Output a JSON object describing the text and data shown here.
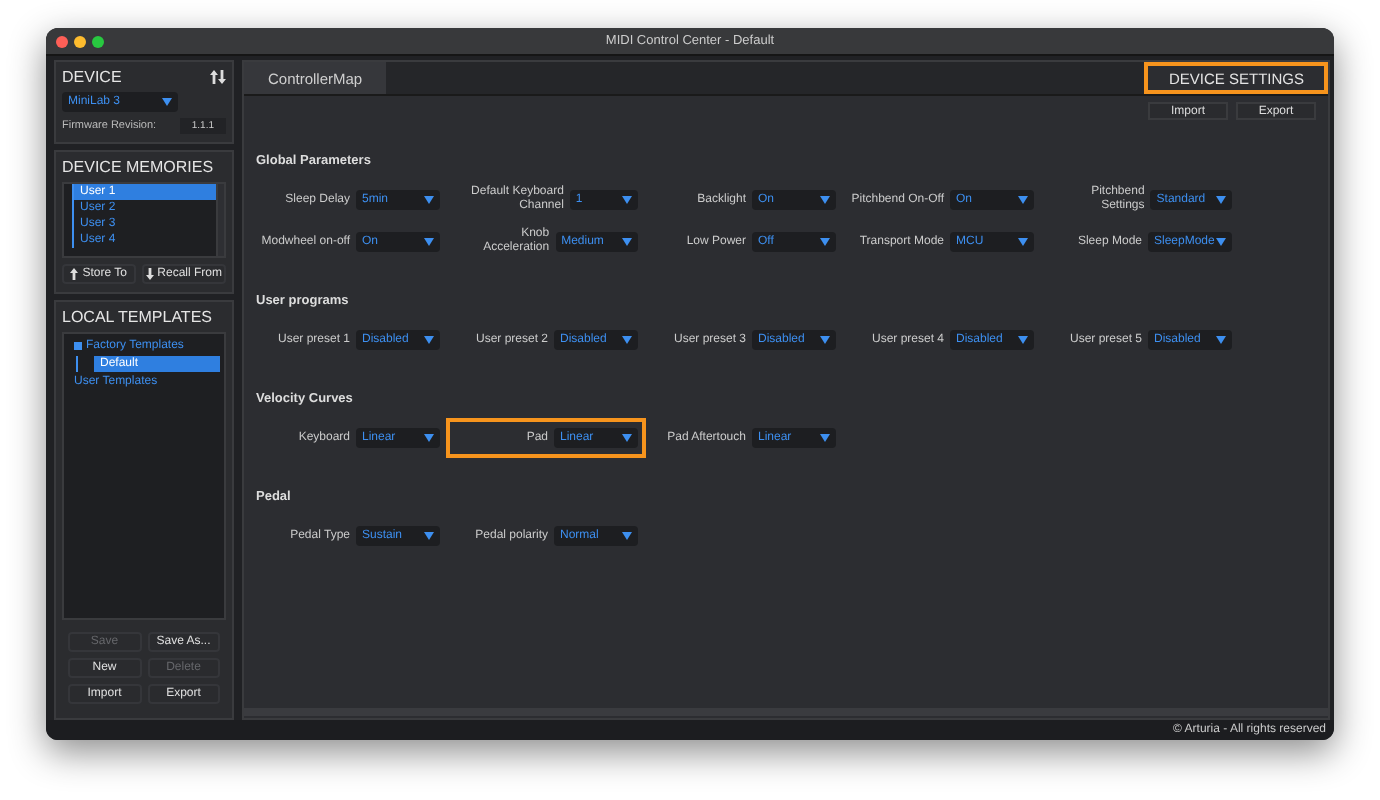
{
  "window": {
    "title": "MIDI Control Center - Default"
  },
  "device": {
    "heading": "DEVICE",
    "model": "MiniLab 3",
    "firmware_label": "Firmware Revision:",
    "firmware_value": "1.1.1"
  },
  "device_memories": {
    "heading": "DEVICE MEMORIES",
    "items": [
      {
        "label": "User 1",
        "selected": true
      },
      {
        "label": "User 2",
        "selected": false
      },
      {
        "label": "User 3",
        "selected": false
      },
      {
        "label": "User 4",
        "selected": false
      }
    ],
    "buttons": [
      {
        "label": "Store To",
        "kind": "up"
      },
      {
        "label": "Recall From",
        "kind": "down"
      }
    ]
  },
  "local_templates": {
    "heading": "LOCAL TEMPLATES",
    "tree": [
      {
        "label": "Factory Templates",
        "selected": false,
        "children": [
          {
            "label": "Default",
            "selected": true
          }
        ]
      },
      {
        "label": "User Templates",
        "selected": false
      }
    ]
  },
  "template_buttons": [
    {
      "label": "Save",
      "disabled": true
    },
    {
      "label": "Save As...",
      "disabled": false
    },
    {
      "label": "New",
      "disabled": false
    },
    {
      "label": "Delete",
      "disabled": true
    },
    {
      "label": "Import",
      "disabled": false
    },
    {
      "label": "Export",
      "disabled": false
    }
  ],
  "tabs": [
    {
      "label": "ControllerMap",
      "selected": false,
      "highlighted": false
    },
    {
      "label": "DEVICE SETTINGS",
      "selected": true,
      "highlighted": true
    }
  ],
  "toolbar_buttons": [
    "Import",
    "Export"
  ],
  "sections": [
    {
      "title": "Global Parameters",
      "rows": [
        [
          {
            "label": "Sleep Delay",
            "value": "5min"
          },
          {
            "label": "Default Keyboard Channel",
            "value": "1"
          },
          {
            "label": "Backlight",
            "value": "On"
          },
          {
            "label": "Pitchbend On-Off",
            "value": "On"
          },
          {
            "label": "Pitchbend Settings",
            "value": "Standard"
          }
        ],
        [
          {
            "label": "Modwheel on-off",
            "value": "On"
          },
          {
            "label": "Knob Acceleration",
            "value": "Medium"
          },
          {
            "label": "Low Power",
            "value": "Off"
          },
          {
            "label": "Transport Mode",
            "value": "MCU"
          },
          {
            "label": "Sleep Mode",
            "value": "SleepMode"
          }
        ]
      ]
    },
    {
      "title": "User programs",
      "rows": [
        [
          {
            "label": "User preset 1",
            "value": "Disabled"
          },
          {
            "label": "User preset 2",
            "value": "Disabled"
          },
          {
            "label": "User preset 3",
            "value": "Disabled"
          },
          {
            "label": "User preset 4",
            "value": "Disabled"
          },
          {
            "label": "User preset 5",
            "value": "Disabled"
          }
        ]
      ]
    },
    {
      "title": "Velocity Curves",
      "rows": [
        [
          {
            "label": "Keyboard",
            "value": "Linear"
          },
          {
            "label": "Pad",
            "value": "Linear",
            "highlighted": true
          },
          {
            "label": "Pad Aftertouch",
            "value": "Linear"
          }
        ]
      ]
    },
    {
      "title": "Pedal",
      "rows": [
        [
          {
            "label": "Pedal Type",
            "value": "Sustain"
          },
          {
            "label": "Pedal polarity",
            "value": "Normal"
          }
        ]
      ]
    }
  ],
  "footer": "© Arturia - All rights reserved"
}
